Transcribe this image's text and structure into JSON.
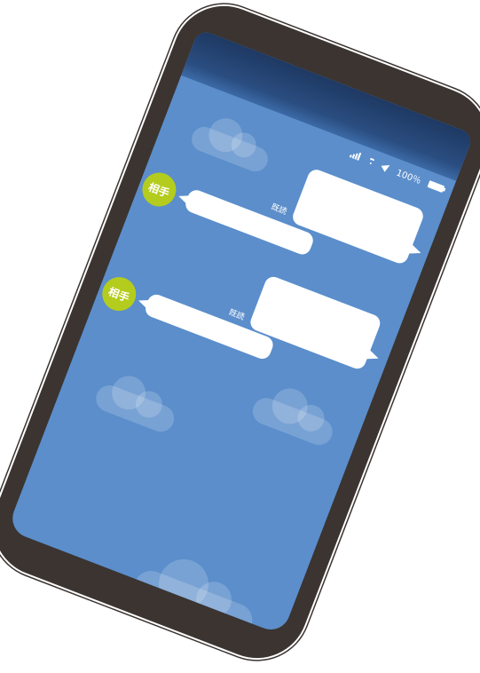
{
  "status_bar": {
    "signal_icon": "signal-bars-icon",
    "wifi_icon": "wifi-icon",
    "location_icon": "location-arrow-icon",
    "battery_text": "100％",
    "battery_icon": "battery-icon"
  },
  "messages": [
    {
      "side": "sent",
      "read_label": "既読"
    },
    {
      "side": "received",
      "sender": "相手"
    },
    {
      "side": "sent",
      "read_label": "既読"
    },
    {
      "side": "received",
      "sender": "相手"
    }
  ],
  "colors": {
    "screen_bg": "#5b8ecb",
    "top_bar": "#1e3963",
    "avatar": "#b4cc1d",
    "phone_frame": "#3b3431"
  }
}
